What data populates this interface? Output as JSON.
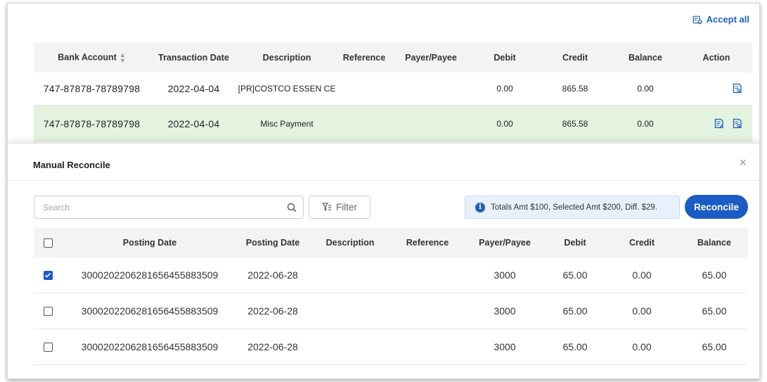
{
  "accept_all": {
    "label": "Accept all"
  },
  "top_table": {
    "headers": [
      "Bank Account",
      "Transaction Date",
      "Description",
      "Reference",
      "Payer/Payee",
      "Debit",
      "Credit",
      "Balance",
      "Action"
    ],
    "rows": [
      {
        "bank_account": "747-87878-78789798",
        "date": "2022-04-04",
        "description": "[PR]COSTCO ESSEN CE",
        "reference": "",
        "payee": "",
        "debit": "0.00",
        "credit": "865.58",
        "balance": "0.00",
        "highlighted": false
      },
      {
        "bank_account": "747-87878-78789798",
        "date": "2022-04-04",
        "description": "Misc Payment",
        "reference": "",
        "payee": "",
        "debit": "0.00",
        "credit": "865.58",
        "balance": "0.00",
        "highlighted": true
      }
    ]
  },
  "panel": {
    "title": "Manual Reconcile",
    "close": "×",
    "search_placeholder": "Search",
    "filter_label": "Filter",
    "totals_text": "Totals Amt $100, Selected Amt $200, Diff. $29.",
    "info_glyph": "i",
    "reconcile_label": "Reconcile",
    "headers": [
      "Posting Date",
      "Posting Date",
      "Description",
      "Reference",
      "Payer/Payee",
      "Debit",
      "Credit",
      "Balance"
    ],
    "rows": [
      {
        "checked": true,
        "posting_id": "3000202206281656455883509",
        "posting_date": "2022-06-28",
        "description": "",
        "reference": "",
        "payee": "3000",
        "debit": "65.00",
        "credit": "0.00",
        "balance": "65.00"
      },
      {
        "checked": false,
        "posting_id": "3000202206281656455883509",
        "posting_date": "2022-06-28",
        "description": "",
        "reference": "",
        "payee": "3000",
        "debit": "65.00",
        "credit": "0.00",
        "balance": "65.00"
      },
      {
        "checked": false,
        "posting_id": "3000202206281656455883509",
        "posting_date": "2022-06-28",
        "description": "",
        "reference": "",
        "payee": "3000",
        "debit": "65.00",
        "credit": "0.00",
        "balance": "65.00"
      }
    ]
  },
  "colors": {
    "accent": "#1a5bc6",
    "highlight_row": "#e4f2e0",
    "totals_bg": "#e8f1fb"
  },
  "icons": {
    "accept_all": "accept-all-icon",
    "action_view": "document-search-icon",
    "action_edit": "document-edit-icon",
    "search": "search-icon",
    "filter": "filter-icon",
    "info": "info-icon"
  }
}
